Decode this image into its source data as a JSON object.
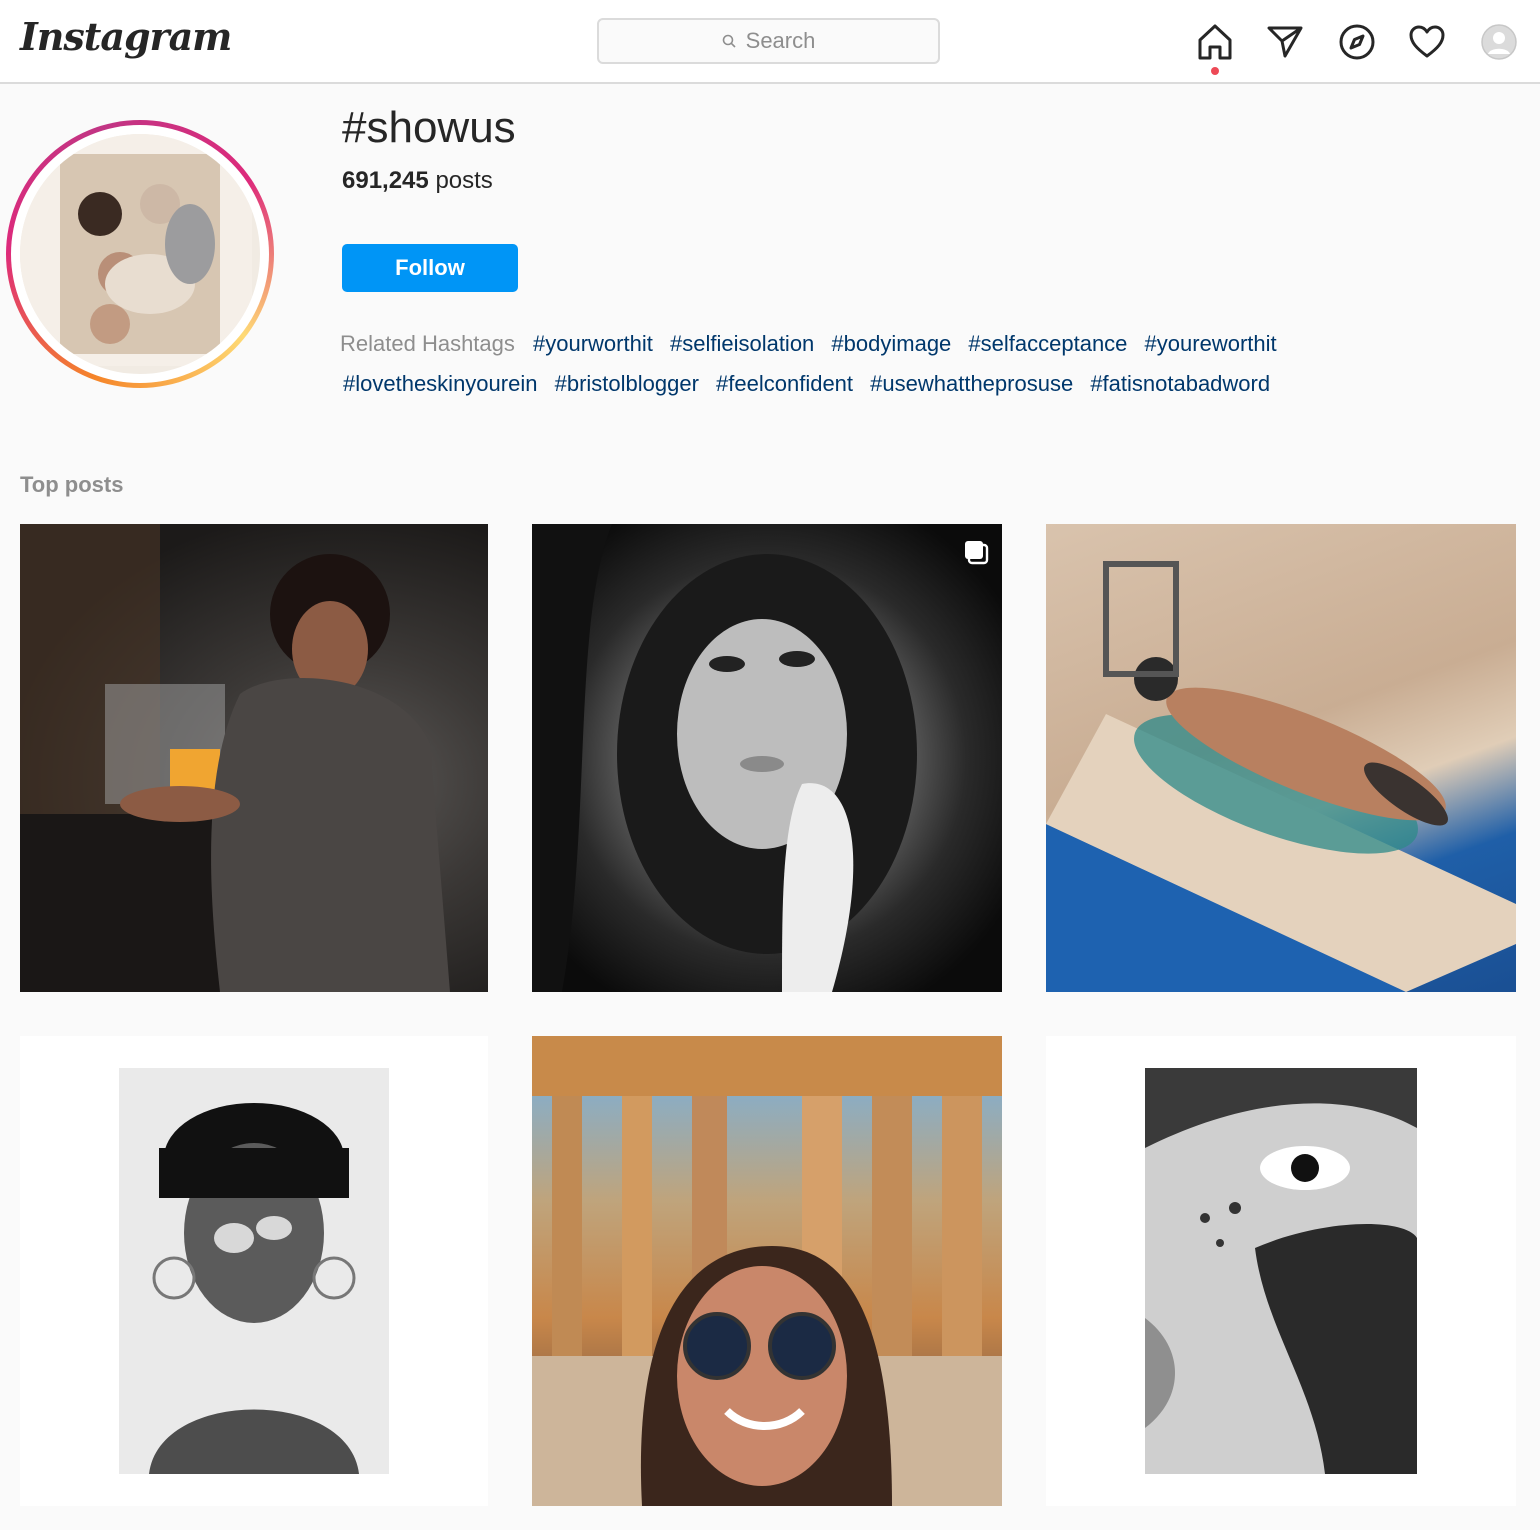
{
  "nav": {
    "logo": "Instagram",
    "search_placeholder": "Search",
    "icons": [
      "home-icon",
      "direct-send-icon",
      "explore-compass-icon",
      "activity-heart-icon",
      "profile-avatar-icon"
    ]
  },
  "hashtag": {
    "title": "#showus",
    "post_count": "691,245",
    "post_count_suffix": "posts",
    "follow_label": "Follow"
  },
  "related": {
    "label": "Related Hashtags",
    "tags": [
      "#yourworthit",
      "#selfieisolation",
      "#bodyimage",
      "#selfacceptance",
      "#youreworthit",
      "#lovetheskinyourein",
      "#bristolblogger",
      "#feelconfident",
      "#usewhattheprosuse",
      "#fatisnotabadword"
    ]
  },
  "top_posts": {
    "label": "Top posts"
  },
  "colors": {
    "accent": "#0095f6",
    "hashtag_link": "#00376b",
    "notification_dot": "#ed4956"
  }
}
